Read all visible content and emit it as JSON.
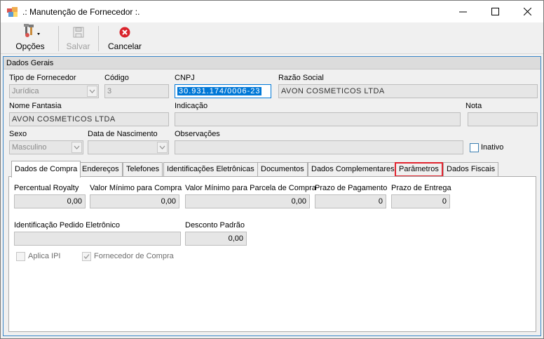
{
  "window": {
    "title": ".: Manutenção de Fornecedor :.",
    "minimize_icon": "minimize-icon",
    "maximize_icon": "maximize-icon",
    "close_icon": "close-icon"
  },
  "toolbar": {
    "options_label": "Opções",
    "save_label": "Salvar",
    "cancel_label": "Cancelar"
  },
  "general": {
    "header": "Dados Gerais",
    "tipo_label": "Tipo de Fornecedor",
    "tipo_value": "Jurídica",
    "codigo_label": "Código",
    "codigo_value": "3",
    "cnpj_label": "CNPJ",
    "cnpj_value": "30.931.174/0006-23",
    "razao_label": "Razão Social",
    "razao_value": "AVON COSMETICOS LTDA",
    "fantasia_label": "Nome Fantasia",
    "fantasia_value": "AVON COSMETICOS LTDA",
    "indicacao_label": "Indicação",
    "indicacao_value": "",
    "nota_label": "Nota",
    "nota_value": "",
    "sexo_label": "Sexo",
    "sexo_value": "Masculino",
    "nascimento_label": "Data de Nascimento",
    "nascimento_value": "",
    "obs_label": "Observações",
    "obs_value": "",
    "inativo_label": "Inativo"
  },
  "tabs": [
    {
      "label": "Dados de Compra"
    },
    {
      "label": "Endereços"
    },
    {
      "label": "Telefones"
    },
    {
      "label": "Identificações Eletrônicas"
    },
    {
      "label": "Documentos"
    },
    {
      "label": "Dados Complementares"
    },
    {
      "label": "Parâmetros"
    },
    {
      "label": "Dados Fiscais"
    }
  ],
  "compra": {
    "royalty_label": "Percentual Royalty",
    "royalty_value": "0,00",
    "valor_min_label": "Valor Mínimo para Compra",
    "valor_min_value": "0,00",
    "valor_parcela_label": "Valor Mínimo para Parcela de Compra",
    "valor_parcela_value": "0,00",
    "prazo_pag_label": "Prazo de Pagamento",
    "prazo_pag_value": "0",
    "prazo_ent_label": "Prazo de Entrega",
    "prazo_ent_value": "0",
    "ident_pedido_label": "Identificação Pedido Eletrônico",
    "ident_pedido_value": "",
    "desconto_label": "Desconto Padrão",
    "desconto_value": "0,00",
    "aplica_ipi_label": "Aplica IPI",
    "fornecedor_compra_label": "Fornecedor de Compra"
  },
  "colors": {
    "accent_border": "#3b87c8",
    "highlight_tab": "#e0242f",
    "selection": "#0078d7"
  }
}
